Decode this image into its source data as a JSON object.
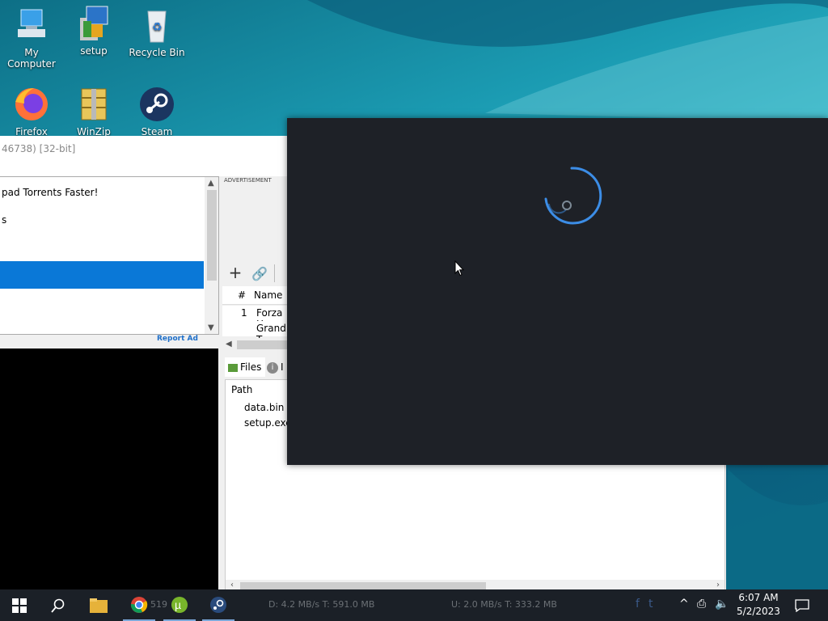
{
  "desktop": {
    "icons": [
      {
        "label": "My Computer",
        "icon": "computer-icon"
      },
      {
        "label": "setup",
        "icon": "setup-installer-icon"
      },
      {
        "label": "Recycle Bin",
        "icon": "recycle-bin-icon"
      },
      {
        "label": "Firefox",
        "icon": "firefox-icon"
      },
      {
        "label": "WinZip",
        "icon": "winzip-icon"
      },
      {
        "label": "Steam",
        "icon": "steam-icon"
      }
    ]
  },
  "utorrent": {
    "title": "46738) [32-bit]",
    "list_items": [
      "pad Torrents Faster!",
      "s",
      ""
    ],
    "report_ad": "Report Ad",
    "advertisement_label": "ADVERTISEMENT",
    "grid_headers": {
      "num": "#",
      "name": "Name"
    },
    "torrents": [
      {
        "num": "1",
        "name": "Forza H"
      },
      {
        "num": "",
        "name": "Grand T"
      }
    ],
    "tabs": [
      {
        "label": "Files",
        "icon": "files-icon"
      },
      {
        "label": "I",
        "icon": "info-icon"
      }
    ],
    "files_header": "Path",
    "files": [
      "data.bin",
      "setup.exe"
    ]
  },
  "taskbar": {
    "status_down": "D: 4.2 MB/s T: 591.0 MB",
    "status_up": "U: 2.0 MB/s T: 333.2 MB",
    "partial": "519",
    "time": "6:07 AM",
    "date": "5/2/2023",
    "apps": [
      "start-icon",
      "search-icon",
      "file-explorer-icon",
      "chrome-icon",
      "utorrent-icon",
      "steam-icon"
    ]
  },
  "colors": {
    "selection": "#0a78d7",
    "overlay_bg": "#1e2127",
    "spinner": "#3c8de6",
    "taskbar": "#1b2027"
  }
}
